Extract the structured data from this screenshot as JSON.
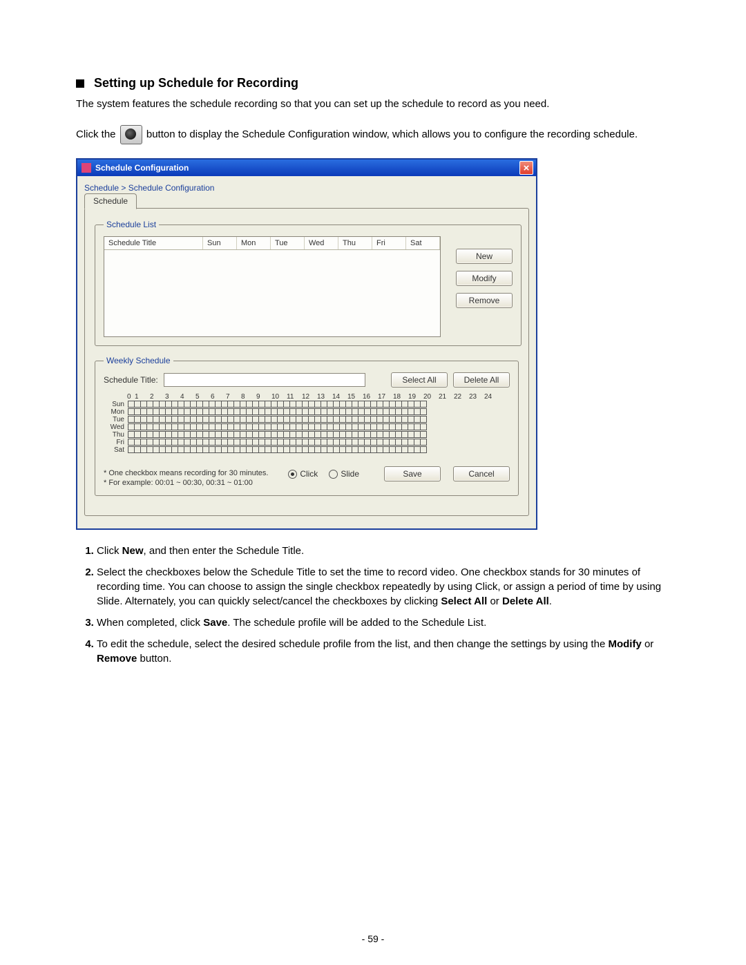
{
  "heading": "Setting up Schedule for Recording",
  "para1": "The system features the schedule recording so that you can set up the schedule to record as you need.",
  "para2_before": "Click the ",
  "para2_after": " button to display the Schedule Configuration window, which allows you to configure the recording schedule.",
  "dialog": {
    "title": "Schedule Configuration",
    "breadcrumb": "Schedule > Schedule Configuration",
    "tab_label": "Schedule",
    "schedule_list": {
      "legend": "Schedule List",
      "cols": [
        "Schedule Title",
        "Sun",
        "Mon",
        "Tue",
        "Wed",
        "Thu",
        "Fri",
        "Sat"
      ],
      "buttons": {
        "new": "New",
        "modify": "Modify",
        "remove": "Remove"
      }
    },
    "weekly": {
      "legend": "Weekly Schedule",
      "title_label": "Schedule Title:",
      "select_all": "Select All",
      "delete_all": "Delete All",
      "hours": [
        "0",
        "1",
        "2",
        "3",
        "4",
        "5",
        "6",
        "7",
        "8",
        "9",
        "10",
        "11",
        "12",
        "13",
        "14",
        "15",
        "16",
        "17",
        "18",
        "19",
        "20",
        "21",
        "22",
        "23",
        "24"
      ],
      "days": [
        "Sun",
        "Mon",
        "Tue",
        "Wed",
        "Thu",
        "Fri",
        "Sat"
      ],
      "foot1": "* One checkbox means recording for 30 minutes.",
      "foot2": "* For example: 00:01 ~ 00:30, 00:31 ~ 01:00",
      "mode_click": "Click",
      "mode_slide": "Slide",
      "save": "Save",
      "cancel": "Cancel"
    }
  },
  "steps": {
    "s1_a": "Click ",
    "s1_b": "New",
    "s1_c": ", and then enter the Schedule Title.",
    "s2_a": "Select the checkboxes below the Schedule Title to set the time to record video. One checkbox stands for 30 minutes of recording time. You can choose to assign the single checkbox repeatedly by using Click, or assign a period of time by using Slide. Alternately, you can quickly select/cancel the checkboxes by clicking ",
    "s2_b": "Select All",
    "s2_c": " or ",
    "s2_d": "Delete All",
    "s2_e": ".",
    "s3_a": "When completed, click ",
    "s3_b": "Save",
    "s3_c": ". The schedule profile will be added to the Schedule List.",
    "s4_a": "To edit the schedule, select the desired schedule profile from the list, and then change the settings by using the ",
    "s4_b": "Modify",
    "s4_c": " or ",
    "s4_d": "Remove",
    "s4_e": " button."
  },
  "page_number": "- 59 -"
}
